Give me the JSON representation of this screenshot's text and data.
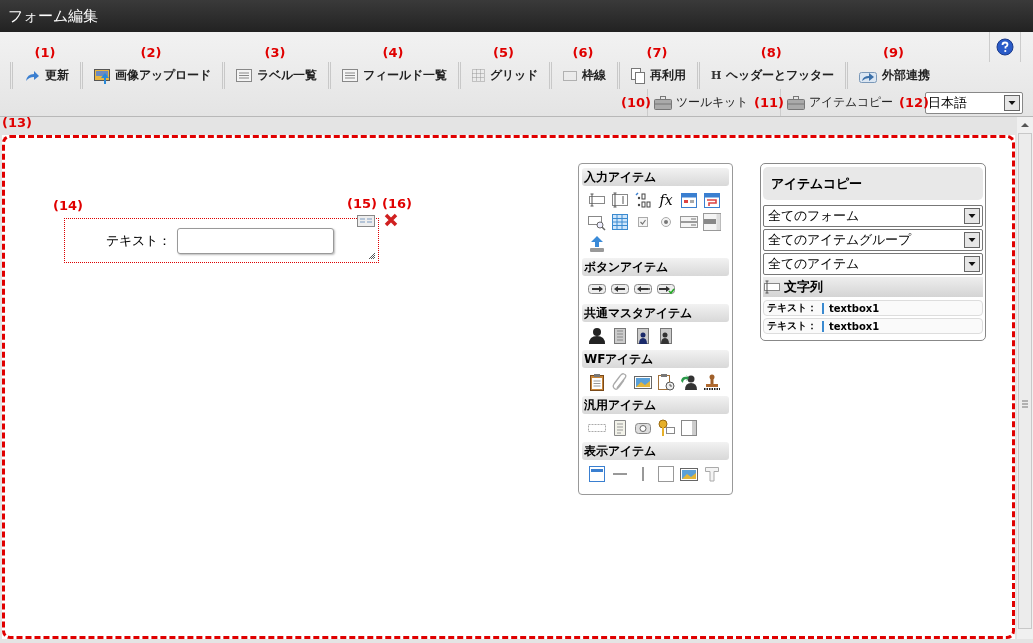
{
  "window": {
    "title": "フォーム編集"
  },
  "toolbar_buttons": [
    {
      "label": "更新",
      "kind": "refresh",
      "annotation": "(1)"
    },
    {
      "label": "画像アップロード",
      "kind": "upload",
      "annotation": "(2)"
    },
    {
      "label": "ラベル一覧",
      "kind": "list",
      "annotation": "(3)"
    },
    {
      "label": "フィールド一覧",
      "kind": "list",
      "annotation": "(4)"
    },
    {
      "label": "グリッド",
      "kind": "grid",
      "annotation": "(5)"
    },
    {
      "label": "枠線",
      "kind": "border",
      "annotation": "(6)"
    },
    {
      "label": "再利用",
      "kind": "reuse",
      "annotation": "(7)"
    },
    {
      "label": "ヘッダーとフッター",
      "kind": "glyph",
      "glyph": "H",
      "annotation": "(8)"
    },
    {
      "label": "外部連携",
      "kind": "share",
      "annotation": "(9)"
    }
  ],
  "secondary_buttons": [
    {
      "label": "ツールキット",
      "annotation": "(10)"
    },
    {
      "label": "アイテムコピー",
      "annotation": "(11)"
    }
  ],
  "language_select": {
    "value": "日本語",
    "annotation": "(12)"
  },
  "canvas": {
    "annotation": "(13)",
    "form_item": {
      "annotation": "(14)",
      "label": "テキスト：",
      "property_annotation": "(15)",
      "delete_annotation": "(16)"
    }
  },
  "toolkit": {
    "sections": [
      {
        "title": "入力アイテム",
        "items": [
          {
            "kind": "textbox"
          },
          {
            "kind": "textarea"
          },
          {
            "kind": "number"
          },
          {
            "kind": "formula",
            "glyph": "fx"
          },
          {
            "kind": "date"
          },
          {
            "kind": "daterange"
          },
          {
            "kind": "lookup"
          },
          {
            "kind": "table"
          },
          {
            "kind": "checkbox"
          },
          {
            "kind": "radio"
          },
          {
            "kind": "pulldown"
          },
          {
            "kind": "listbox"
          },
          {
            "kind": "upload"
          }
        ]
      },
      {
        "title": "ボタンアイテム",
        "items": [
          {
            "kind": "next"
          },
          {
            "kind": "prev"
          },
          {
            "kind": "back"
          },
          {
            "kind": "confirm"
          }
        ]
      },
      {
        "title": "共通マスタアイテム",
        "items": [
          {
            "kind": "user"
          },
          {
            "kind": "company"
          },
          {
            "kind": "orguser"
          },
          {
            "kind": "orgmember"
          }
        ]
      },
      {
        "title": "WFアイテム",
        "items": [
          {
            "kind": "clipboard"
          },
          {
            "kind": "clip"
          },
          {
            "kind": "image"
          },
          {
            "kind": "history"
          },
          {
            "kind": "proxy"
          },
          {
            "kind": "stamp"
          }
        ]
      },
      {
        "title": "汎用アイテム",
        "items": [
          {
            "kind": "dashed"
          },
          {
            "kind": "document"
          },
          {
            "kind": "camera"
          },
          {
            "kind": "key"
          },
          {
            "kind": "panel"
          }
        ]
      },
      {
        "title": "表示アイテム",
        "items": [
          {
            "kind": "header"
          },
          {
            "kind": "hline"
          },
          {
            "kind": "vline"
          },
          {
            "kind": "square"
          },
          {
            "kind": "image"
          },
          {
            "kind": "tletter"
          }
        ]
      }
    ]
  },
  "item_copy": {
    "title": "アイテムコピー",
    "filters": [
      "全てのフォーム",
      "全てのアイテムグループ",
      "全てのアイテム"
    ],
    "group": {
      "title": "文字列",
      "rows": [
        {
          "label": "テキスト：",
          "name": "textbox1"
        },
        {
          "label": "テキスト：",
          "name": "textbox1"
        }
      ]
    }
  }
}
